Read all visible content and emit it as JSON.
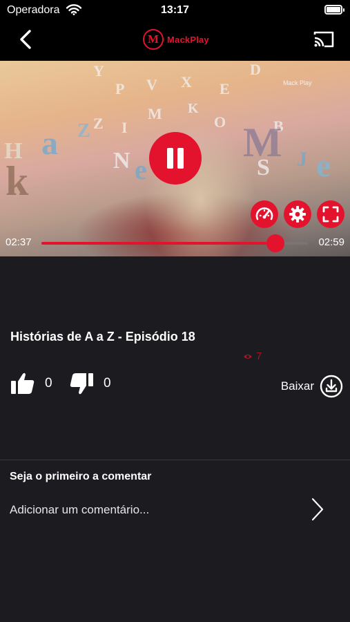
{
  "status_bar": {
    "carrier": "Operadora",
    "time": "13:17"
  },
  "header": {
    "logo_letter": "M",
    "logo_text": "MackPlay"
  },
  "player": {
    "current_time": "02:37",
    "duration": "02:59",
    "progress": 0.877,
    "state": "playing",
    "overlay_brand": "Mack Play"
  },
  "video": {
    "title": "Histórias de A a Z - Episódio 18",
    "views": "7",
    "likes": "0",
    "dislikes": "0",
    "download_label": "Baixar"
  },
  "comments": {
    "heading": "Seja o primeiro a comentar",
    "placeholder": "Adicionar um comentário..."
  },
  "colors": {
    "accent": "#e3132e",
    "background": "#1c1c20",
    "header": "#000000"
  },
  "icons": [
    "wifi-icon",
    "battery-icon",
    "back-arrow-icon",
    "cast-icon",
    "pause-icon",
    "speed-gauge-icon",
    "gear-icon",
    "fullscreen-icon",
    "eye-icon",
    "thumbs-up-icon",
    "thumbs-down-icon",
    "download-icon",
    "chevron-right-icon"
  ]
}
